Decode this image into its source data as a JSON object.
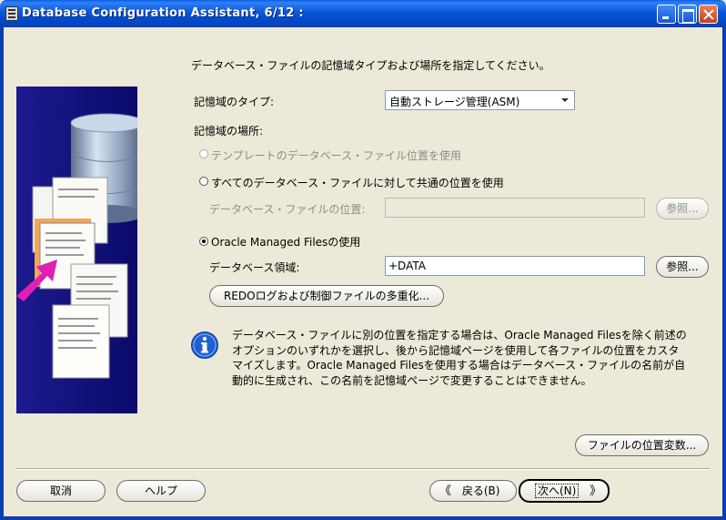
{
  "window": {
    "title": "Database Configuration Assistant, 6/12 :"
  },
  "main": {
    "heading": "データベース・ファイルの記憶域タイプおよび場所を指定してください。",
    "storage_type_label": "記憶域のタイプ:",
    "storage_type_value": "自動ストレージ管理(ASM)",
    "location_label": "記憶域の場所:",
    "radio_template": "テンプレートのデータベース・ファイル位置を使用",
    "radio_common": "すべてのデータベース・ファイルに対して共通の位置を使用",
    "db_file_location_label": "データベース・ファイルの位置:",
    "db_file_location_value": "",
    "browse_1": "参照...",
    "radio_omf": "Oracle Managed Filesの使用",
    "db_area_label": "データベース領域:",
    "db_area_value": "+DATA",
    "browse_2": "参照...",
    "multiplex_button": "REDOログおよび制御ファイルの多重化...",
    "note_lines": [
      "データベース・ファイルに別の位置を指定する場合は、Oracle Managed Filesを除く前述の",
      "オプションのいずれかを選択し、後から記憶域ページを使用して各ファイルの位置をカスタ",
      "マイズします。Oracle Managed Filesを使用する場合はデータベース・ファイルの名前が自",
      "動的に生成され、この名前を記憶域ページで変更することはできません。"
    ],
    "file_location_vars_button": "ファイルの位置変数..."
  },
  "footer": {
    "cancel": "取消",
    "help": "ヘルプ",
    "back": "戻る(B)",
    "next": "次へ(N)"
  },
  "colors": {
    "titlebar": "#0a56d8",
    "dialog_bg": "#ece9d8",
    "illustration_bg": "#0b0a6a",
    "info_icon": "#1f5fd1"
  },
  "icons": {
    "info": "info-icon",
    "back": "chevron-left-double-icon",
    "next": "chevron-right-double-icon"
  }
}
